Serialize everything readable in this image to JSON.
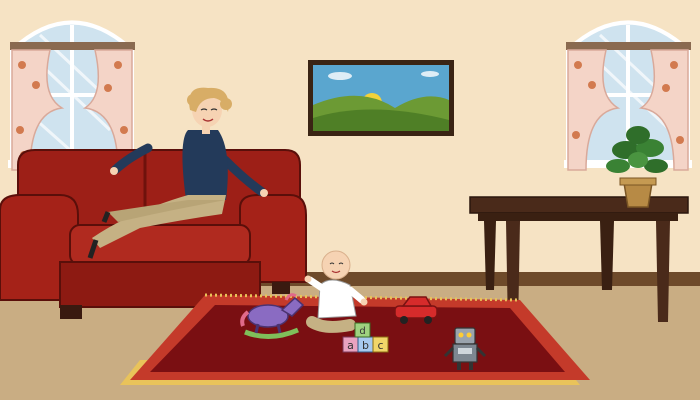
{
  "scene": {
    "colors": {
      "wall": "#f6e3c4",
      "floor": "#c9ad83",
      "baseboard": "#6e4a2a",
      "sofa": "#9d1f17",
      "sofa_dark": "#6f120c",
      "rug": "#7a0f12",
      "rug_border": "#c43a2a",
      "table": "#4a2a1a",
      "window_sky": "#cfe3ef",
      "curtain": "#f4d4c7",
      "flower": "#d27a4f",
      "woman_top": "#233a5a",
      "woman_pants": "#c5b184",
      "woman_hair": "#d8ad66",
      "baby_shirt": "#ffffff",
      "painting_sky": "#5aa6cf",
      "painting_hill": "#6c9a34",
      "sun": "#f3d23a"
    },
    "toys": {
      "blocks": [
        "a",
        "b",
        "c",
        "d"
      ]
    }
  }
}
